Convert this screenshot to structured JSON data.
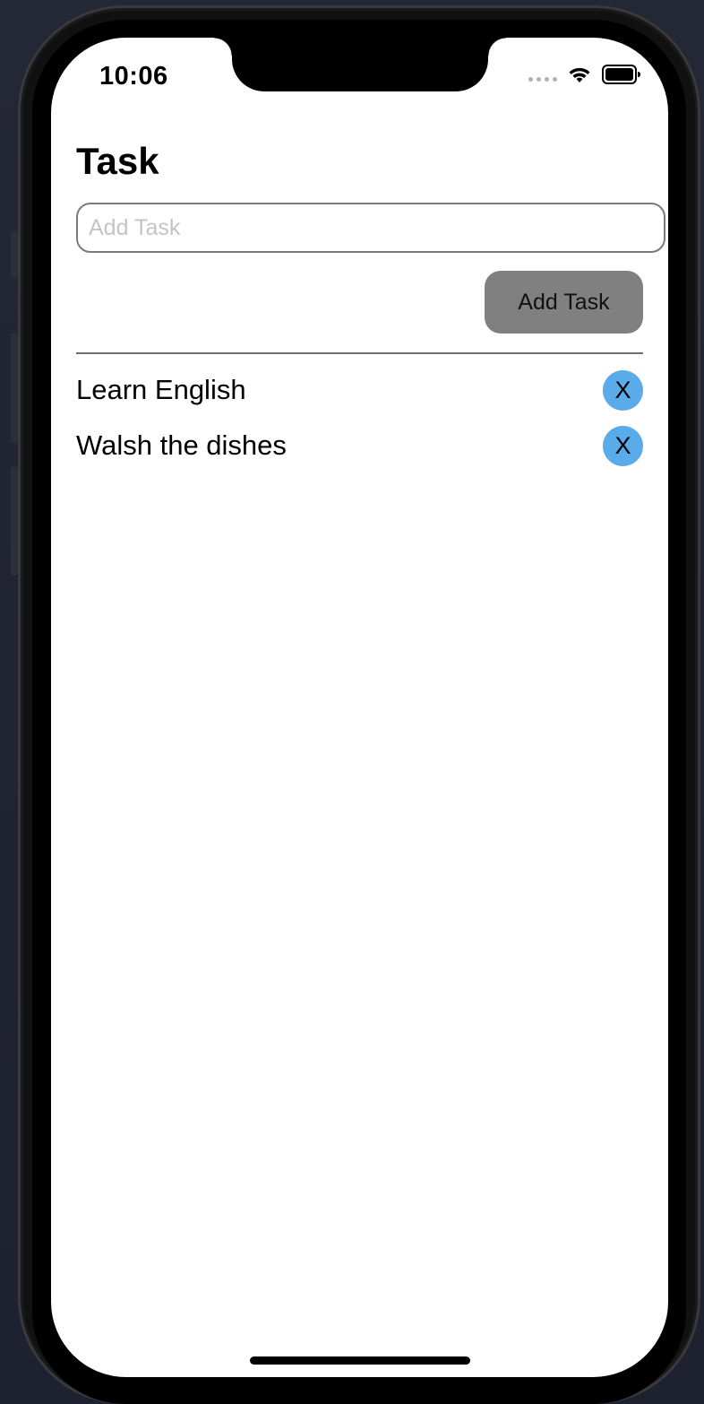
{
  "status_bar": {
    "time": "10:06",
    "icons": [
      "cellular-signal-icon",
      "wifi-icon",
      "battery-icon"
    ]
  },
  "screen": {
    "title": "Task",
    "input": {
      "value": "",
      "placeholder": "Add Task"
    },
    "add_button_label": "Add Task",
    "tasks": [
      {
        "label": "Learn English",
        "delete_label": "X"
      },
      {
        "label": "Walsh the dishes",
        "delete_label": "X"
      }
    ]
  },
  "colors": {
    "add_button_bg": "#808080",
    "delete_button_bg": "#5aabe9",
    "screen_bg": "#ffffff",
    "backdrop": "#1f2230"
  }
}
